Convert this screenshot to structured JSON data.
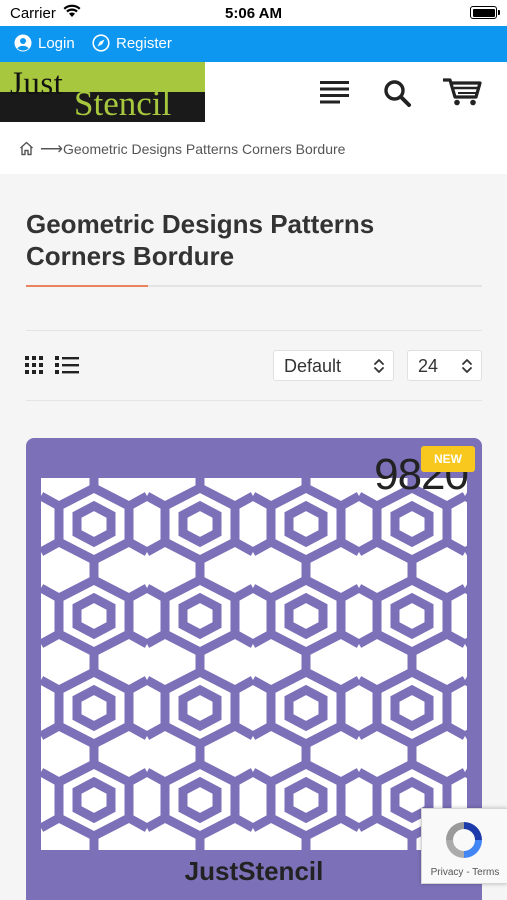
{
  "status_bar": {
    "carrier": "Carrier",
    "time": "5:06 AM"
  },
  "topbar": {
    "login": "Login",
    "register": "Register",
    "color": "#0d97f1"
  },
  "header": {
    "logo_word1": "Just",
    "logo_word2": "Stencil",
    "icons": [
      "menu-icon",
      "search-icon",
      "cart-icon"
    ]
  },
  "breadcrumb": {
    "home_icon": "home-icon",
    "current": "Geometric Designs Patterns Corners Bordure"
  },
  "page": {
    "title": "Geometric Designs Patterns Corners Bordure"
  },
  "toolbar": {
    "view_icons": [
      "grid-view-icon",
      "list-view-icon"
    ],
    "sort_value": "Default",
    "per_page_value": "24"
  },
  "product": {
    "badge": "NEW",
    "code": "9820",
    "brand": "JustStencil",
    "color": "#7c70b8"
  },
  "recaptcha": {
    "terms": "Privacy - Terms"
  }
}
